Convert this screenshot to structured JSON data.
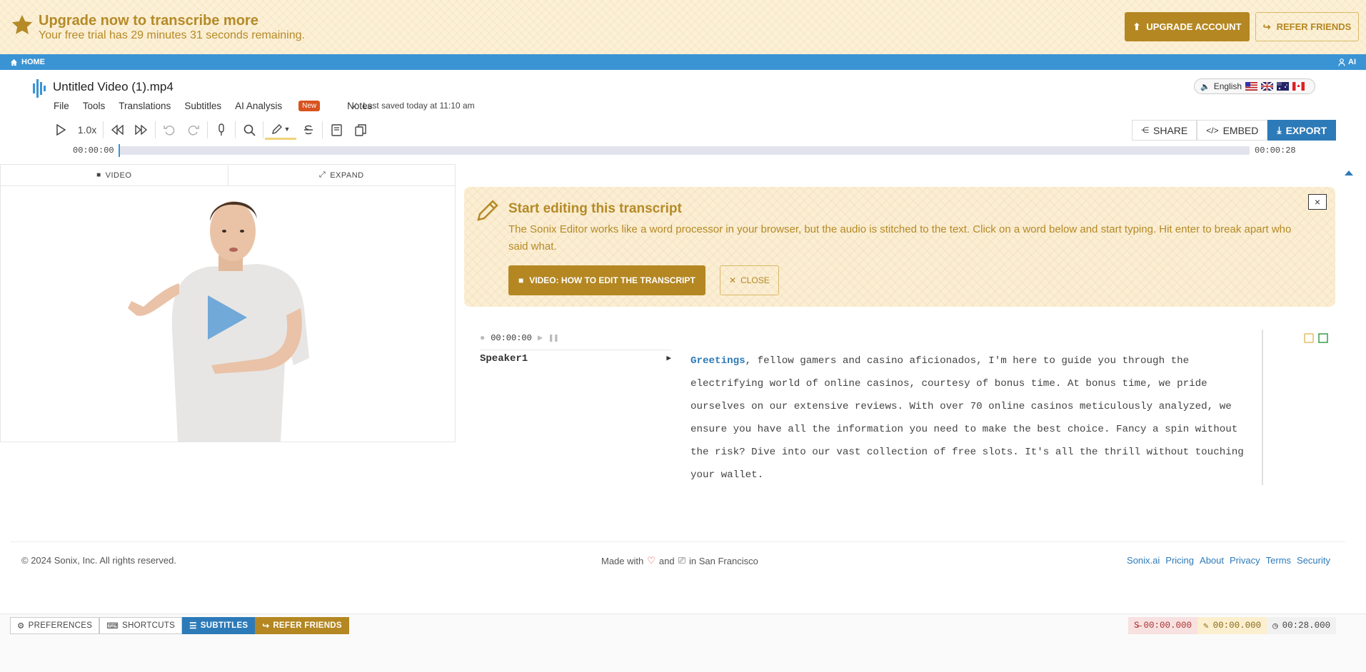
{
  "banner": {
    "title": "Upgrade now to transcribe more",
    "subtitle": "Your free trial has 29 minutes 31 seconds remaining.",
    "upgrade_label": "UPGRADE ACCOUNT",
    "refer_label": "REFER FRIENDS"
  },
  "homebar": {
    "home_label": "HOME",
    "user_label": "AI"
  },
  "document": {
    "title": "Untitled Video (1).mp4",
    "menu": [
      "File",
      "Tools",
      "Translations",
      "Subtitles",
      "AI Analysis",
      "Notes"
    ],
    "new_badge": "New",
    "saved_text": "Last saved today at 11:10 am"
  },
  "language": {
    "label": "English"
  },
  "toolbar": {
    "speed": "1.0x"
  },
  "share": {
    "share_label": "SHARE",
    "embed_label": "EMBED",
    "export_label": "EXPORT"
  },
  "timeline": {
    "start": "00:00:00",
    "end": "00:00:28",
    "progress": 0
  },
  "media": {
    "video_tab": "VIDEO",
    "expand_tab": "EXPAND"
  },
  "notice": {
    "title": "Start editing this transcript",
    "body": "The Sonix Editor works like a word processor in your browser, but the audio is stitched to the text. Click on a word below and start typing. Hit enter to break apart who said what.",
    "video_button": "VIDEO: HOW TO EDIT THE TRANSCRIPT",
    "close_button": "CLOSE",
    "x": "×"
  },
  "segment": {
    "time": "00:00:00",
    "speaker": "Speaker1",
    "first_word": "Greetings",
    "text": ", fellow gamers and casino aficionados, I'm here to guide you through the electrifying world of online casinos, courtesy of bonus time. At bonus time, we pride ourselves on our extensive reviews. With over 70 online casinos meticulously analyzed, we ensure you have all the information you need to make the best choice. Fancy a spin without the risk? Dive into our vast collection of free slots. It's all the thrill without touching your wallet."
  },
  "footer": {
    "copyright": "© 2024 Sonix, Inc. All rights reserved.",
    "made_with": "Made with",
    "and": "and",
    "in_sf": "in San Francisco",
    "links": [
      "Sonix.ai",
      "Pricing",
      "About",
      "Privacy",
      "Terms",
      "Security"
    ]
  },
  "bottom": {
    "preferences": "PREFERENCES",
    "shortcuts": "SHORTCUTS",
    "subtitles": "SUBTITLES",
    "refer": "REFER FRIENDS",
    "timer_strike": "00:00.000",
    "timer_edit": "00:00.000",
    "timer_total": "00:28.000"
  },
  "colors": {
    "gold": "#b48722",
    "blue": "#2d7ab8",
    "homebar": "#3a94d4",
    "banner_bg": "#fcf0d6"
  }
}
